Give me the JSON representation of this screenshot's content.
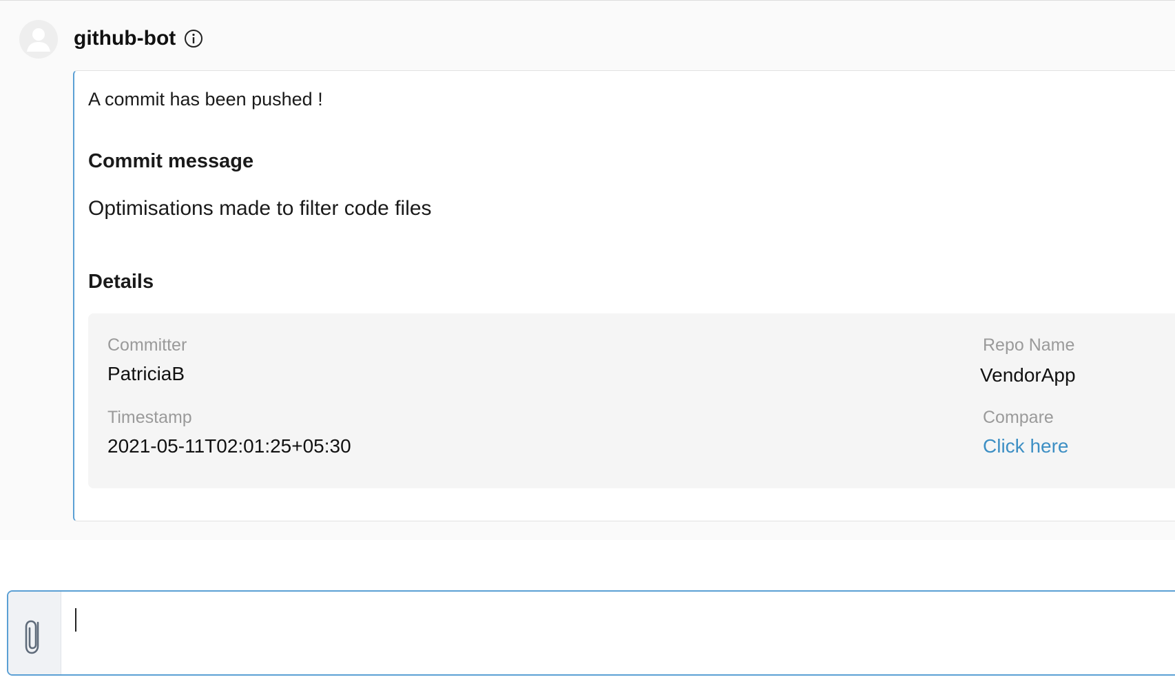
{
  "message": {
    "sender": "github-bot",
    "intro": "A commit has been pushed !",
    "commit_message_title": "Commit message",
    "commit_message": "Optimisations made to filter code files",
    "details_title": "Details",
    "details": {
      "committer_label": "Committer",
      "committer_value": "PatriciaB",
      "timestamp_label": "Timestamp",
      "timestamp_value": "2021-05-11T02:01:25+05:30",
      "repo_label": "Repo Name",
      "repo_value": "VendorApp",
      "compare_label": "Compare",
      "compare_link": "Click here"
    }
  },
  "composer": {
    "value": "",
    "attach_icon": "paperclip-icon"
  },
  "colors": {
    "accent": "#5a9fd4",
    "link": "#3d8fc4",
    "details_bg": "#f5f5f5"
  }
}
